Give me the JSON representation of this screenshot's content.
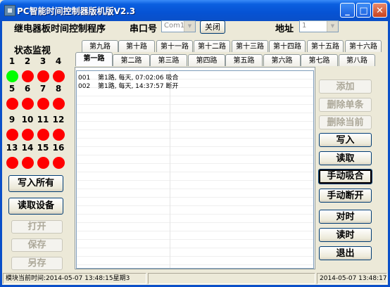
{
  "window": {
    "title": "PC智能时间控制器版机版V2.3"
  },
  "header": {
    "app_label": "继电器板时间控制程序",
    "port_label": "串口号",
    "port_value": "Com1",
    "close_label": "关闭",
    "address_label": "地址",
    "address_value": "1"
  },
  "status_panel": {
    "title": "状态监视",
    "leds": [
      {
        "num": "1",
        "state": "on"
      },
      {
        "num": "2",
        "state": "off"
      },
      {
        "num": "3",
        "state": "off"
      },
      {
        "num": "4",
        "state": "off"
      },
      {
        "num": "5",
        "state": "off"
      },
      {
        "num": "6",
        "state": "off"
      },
      {
        "num": "7",
        "state": "off"
      },
      {
        "num": "8",
        "state": "off"
      },
      {
        "num": "9",
        "state": "off"
      },
      {
        "num": "10",
        "state": "off"
      },
      {
        "num": "11",
        "state": "off"
      },
      {
        "num": "12",
        "state": "off"
      },
      {
        "num": "13",
        "state": "off"
      },
      {
        "num": "14",
        "state": "off"
      },
      {
        "num": "15",
        "state": "off"
      },
      {
        "num": "16",
        "state": "off"
      }
    ],
    "colors": {
      "on": "#00ff00",
      "off": "#ff0000"
    }
  },
  "left_buttons": {
    "write_all": "写入所有",
    "read_device": "读取设备",
    "open": "打开",
    "save": "保存",
    "save_as": "另存"
  },
  "tabs": {
    "row_top": [
      "第九路",
      "第十路",
      "第十一路",
      "第十二路",
      "第十三路",
      "第十四路",
      "第十五路",
      "第十六路"
    ],
    "row_bottom": [
      "第一路",
      "第二路",
      "第三路",
      "第四路",
      "第五路",
      "第六路",
      "第七路",
      "第八路"
    ],
    "active": "第一路"
  },
  "schedule_list": [
    {
      "no": "001",
      "text": "第1路, 每天, 07:02:06 吸合"
    },
    {
      "no": "002",
      "text": "第1路, 每天, 14:37:57 断开"
    }
  ],
  "right_buttons": {
    "add": "添加",
    "delete_one": "删除单条",
    "delete_current": "删除当前",
    "write": "写入",
    "read": "读取",
    "manual_close": "手动吸合",
    "manual_open": "手动断开",
    "sync_time": "对时",
    "read_time": "读时",
    "exit": "退出"
  },
  "statusbar": {
    "module_time": "模块当前时间:2014-05-07 13:48:15星期3",
    "middle": "",
    "pc_time": "2014-05-07 13:48:17"
  }
}
